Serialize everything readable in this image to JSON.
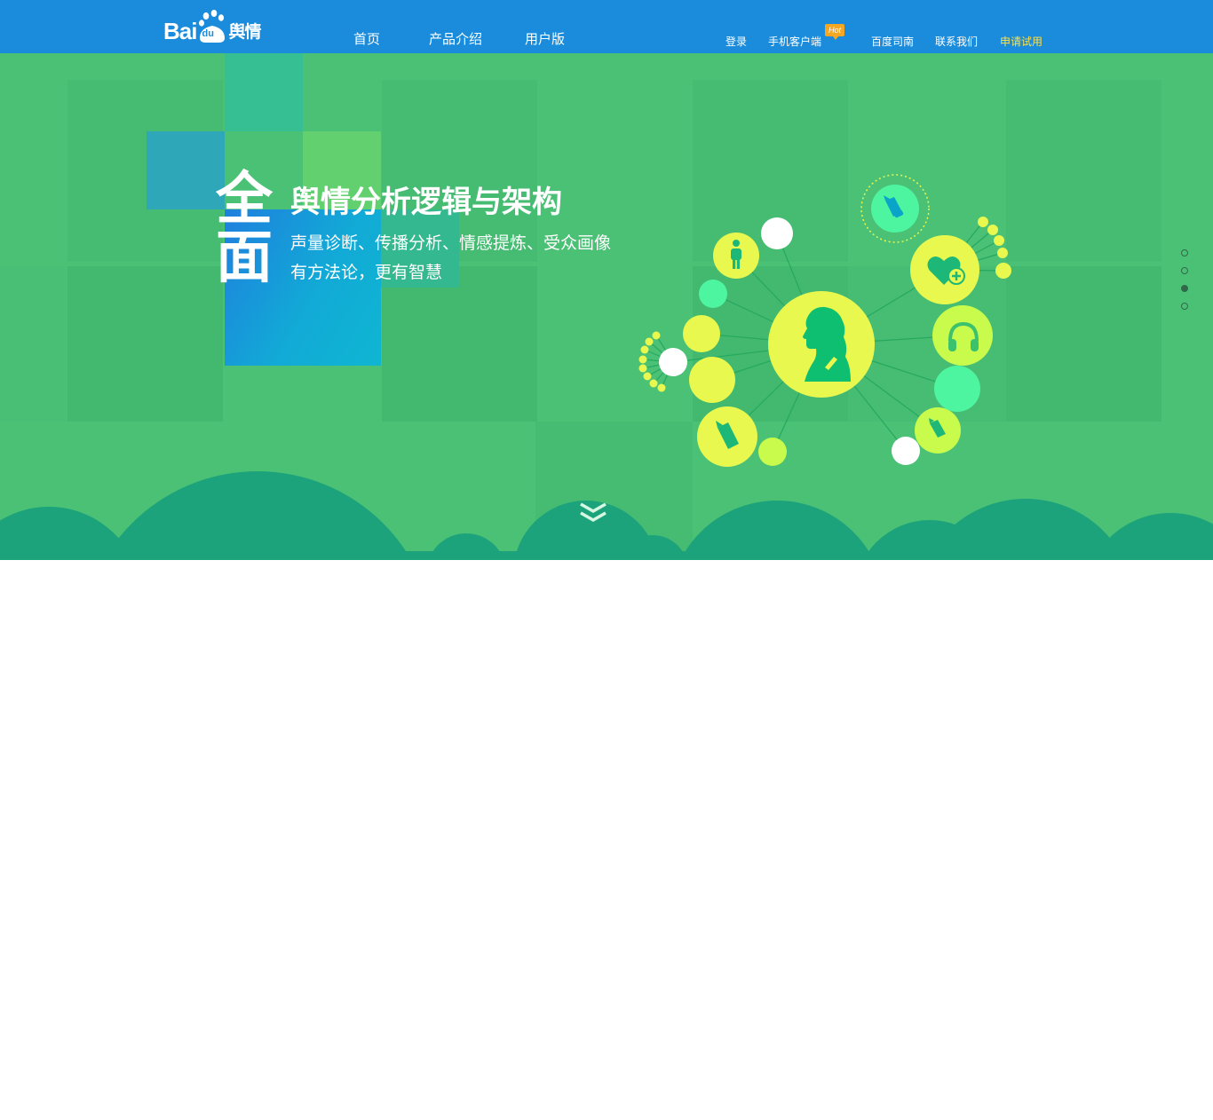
{
  "header": {
    "logo": {
      "brand_latin": "Bai",
      "brand_paw": "du",
      "product": "舆情"
    },
    "nav_main": [
      "首页",
      "产品介绍",
      "用户版"
    ],
    "nav_right": {
      "login": "登录",
      "mobile": "手机客户端",
      "hot_badge": "Hot",
      "guide": "百度司南",
      "contact": "联系我们",
      "apply": "申请试用"
    }
  },
  "hero": {
    "big_word": [
      "全",
      "面"
    ],
    "headline": "舆情分析逻辑与架构",
    "subline_1": "声量诊断、传播分析、情感提炼、受众画像",
    "subline_2": "有方法论，更有智慧",
    "slide_count": 4,
    "active_slide": 3
  },
  "icons": {
    "center": "woman-profile-icon",
    "satellites": [
      "person-icon",
      "heart-plus-icon",
      "headphones-icon",
      "pencil-icon",
      "scroll-down-icon"
    ]
  },
  "colors": {
    "topbar": "#1a8cdb",
    "hero_bg": "#4bc175",
    "hills": "#1ca37b",
    "apply_link": "#ffe14d",
    "node_yellow": "#e8f84e",
    "node_mint": "#4df5a0"
  }
}
